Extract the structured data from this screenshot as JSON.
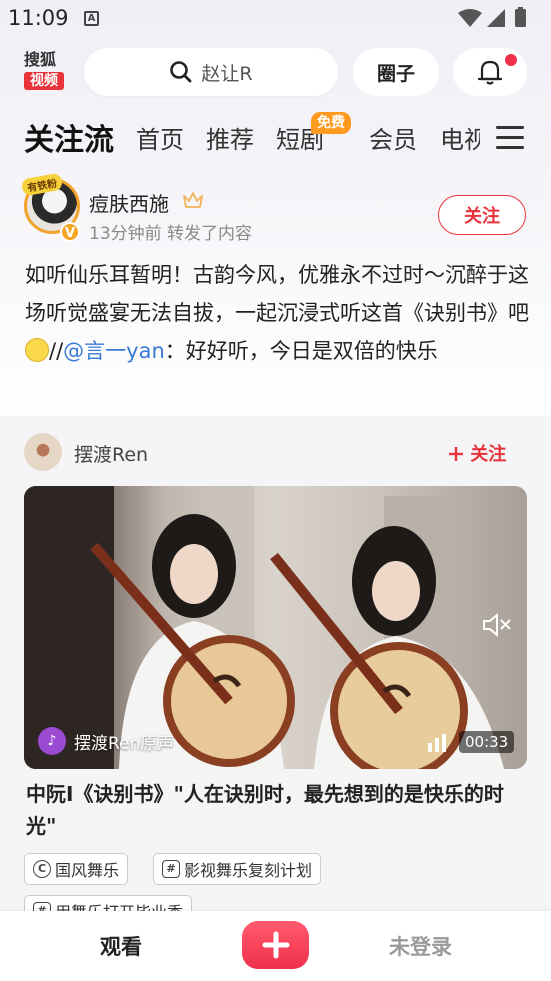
{
  "status_bar": {
    "time": "11:09",
    "notification_glyph": "A"
  },
  "header": {
    "logo_top": "搜狐",
    "logo_bottom": "视频",
    "search_text": "赵让R",
    "circle_label": "圈子"
  },
  "tabs": [
    {
      "label": "关注流",
      "active": true
    },
    {
      "label": "首页"
    },
    {
      "label": "推荐"
    },
    {
      "label": "短剧",
      "badge": "免费"
    },
    {
      "label": "会员"
    },
    {
      "label": "电视剧"
    }
  ],
  "post": {
    "author": "痘肤西施",
    "avatar_badge": "有铁粉",
    "verified_badge": "V",
    "meta": "13分钟前  转发了内容",
    "follow_label": "关注",
    "text_before": "如听仙乐耳暂明！古韵今风，优雅永不过时～沉醉于这场听觉盛宴无法自拔，一起沉浸式听这首《诀别书》吧",
    "text_sep": "//",
    "mention": "@言一yan",
    "text_after": "：好好听，今日是双倍的快乐"
  },
  "repost": {
    "author": "摆渡Ren",
    "follow_label": "关注",
    "audio_label": "摆渡Ren原声",
    "audio_glyph": "♪",
    "duration": "00:33",
    "title": "中阮I《诀别书》\"人在诀别时，最先想到的是快乐的时光\"",
    "tags": [
      {
        "label": "国风舞乐",
        "icon": "topic-circle-icon",
        "glyph": "C"
      },
      {
        "label": "影视舞乐复刻计划",
        "icon": "hashtag-icon",
        "glyph": "#"
      },
      {
        "label": "用舞乐打开毕业季",
        "icon": "hashtag-icon",
        "glyph": "#"
      }
    ]
  },
  "bottom_bar": {
    "watch_label": "观看",
    "login_label": "未登录"
  },
  "colors": {
    "accent_red": "#e8333a",
    "mention_blue": "#3a7bd5",
    "free_badge": "#ff9a1f"
  }
}
